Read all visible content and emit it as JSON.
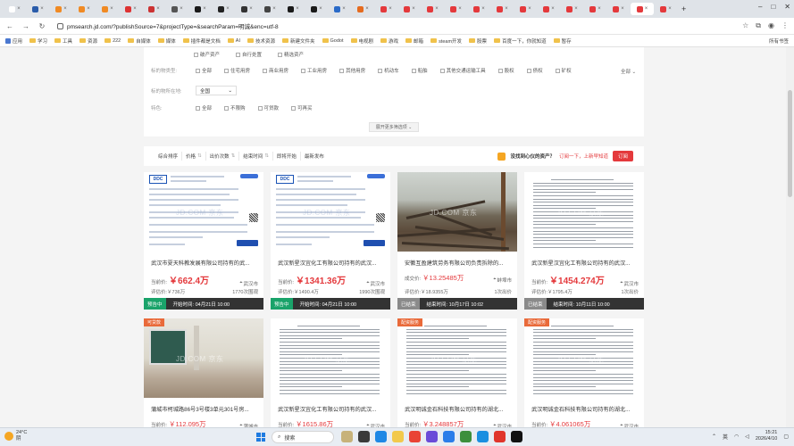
{
  "browser": {
    "tab_glyphs": [
      "",
      "",
      "",
      "",
      "",
      "",
      "",
      "",
      "",
      "",
      "",
      "",
      "",
      "",
      "",
      "",
      "",
      "",
      "",
      "",
      "",
      "",
      "",
      "",
      "",
      "",
      "",
      "",
      ""
    ],
    "tab_colors": [
      "#ffffff",
      "#2a5caa",
      "#f08a24",
      "#f08a24",
      "#f08a24",
      "#d33",
      "#c33",
      "#555",
      "#1a1a1a",
      "#222",
      "#333",
      "#444",
      "#1a1a1a",
      "#1a1a1a",
      "#2a6ac8",
      "#e56b1f",
      "#e4393c",
      "#e4393c",
      "#e4393c",
      "#e4393c",
      "#e4393c",
      "#e4393c",
      "#e4393c",
      "#e4393c",
      "#e4393c",
      "#e4393c",
      "#e4393c",
      "#e4393c",
      "#e4393c"
    ],
    "new_tab": "+",
    "url": "pmsearch.jd.com/?publishSource=7&projectType=&searchParam=明诚&enc=utf-8",
    "bookmarks": [
      "应用",
      "学习",
      "工具",
      "资源",
      "222",
      "自媒体",
      "媒体",
      "插件都是文档",
      "AI",
      "技术资源",
      "新建文件夹",
      "Godot",
      "电视剧",
      "游戏",
      "邮箱",
      "steam开发",
      "股票",
      "百度一下，你就知道",
      "暂存"
    ],
    "bookmarks_right": "所有书签"
  },
  "filters": {
    "row1_options": [
      "破产资产",
      "自行处置",
      "精选资产"
    ],
    "row2_label": "标的物类型:",
    "row2_options": [
      "全部",
      "住宅用房",
      "商业用房",
      "工业用房",
      "其他用房",
      "机动车",
      "船舶",
      "其他交通运输工具",
      "股权",
      "债权",
      "矿权"
    ],
    "row2_more": "全部",
    "row3_label": "标的物所在地:",
    "row3_select": "全国",
    "row4_label": "特色:",
    "row4_options": [
      "全部",
      "不限购",
      "可贷款",
      "可再买"
    ],
    "expand_label": "展开更多筛选项"
  },
  "sort": {
    "items": [
      "综合排序",
      "价格",
      "出价次数",
      "结束时间",
      "即将开始",
      "最新发布"
    ],
    "promo_text": "没找到心仪的资产？",
    "promo_link": "订阅一下，上新早知道",
    "subscribe_button": "订阅"
  },
  "watermark": "JD.COM 京东",
  "cards": [
    {
      "tag": "",
      "cert_logo": "DDC",
      "title": "武汉市夏天科教发展有限公司持有的武...",
      "price_label": "当前价:",
      "price": "￥662.4万",
      "location": "武汉市",
      "eval": "评估价:￥736万",
      "count": "1770次围观",
      "status": "预告中",
      "time": "开始时间: 04月21日 10:00"
    },
    {
      "tag": "",
      "cert_logo": "DDC",
      "title": "武汉新星汉宜化工有限公司持有的武汉...",
      "price_label": "当前价:",
      "price": "￥1341.36万",
      "location": "武汉市",
      "eval": "评估价:￥1490.4万",
      "count": "1990次围观",
      "status": "预告中",
      "time": "开始时间: 04月21日 10:00"
    },
    {
      "tag": "",
      "cert_logo": "",
      "title": "安徽互盈建筑劳务有限公司负责拆除的...",
      "price_label": "成交价:",
      "price": "￥13.25485万",
      "location": "蚌埠市",
      "eval": "评估价:￥18.9355万",
      "count": "1次出价",
      "status": "已结束",
      "time": "结束时间: 10月17日 10:02"
    },
    {
      "tag": "",
      "cert_logo": "",
      "title": "武汉新星汉宜化工有限公司持有的武汉...",
      "price_label": "当前价:",
      "price": "￥1454.274万",
      "location": "武汉市",
      "eval": "评估价:￥1795.4万",
      "count": "1次出价",
      "status": "已结束",
      "time": "结束时间: 10月11日 10:00"
    },
    {
      "tag": "可贷款",
      "cert_logo": "",
      "title": "蒲城市柯城路86号3号楼3单元301号房...",
      "price_label": "当前价:",
      "price": "￥112.095万",
      "location": "蒲城市",
      "eval": "",
      "count": "",
      "status": "",
      "time": ""
    },
    {
      "tag": "",
      "cert_logo": "",
      "title": "武汉新星汉宜化工有限公司持有的武汉...",
      "price_label": "当前价:",
      "price": "￥1615.86万",
      "location": "武汉市",
      "eval": "",
      "count": "",
      "status": "",
      "time": ""
    },
    {
      "tag": "配资服务",
      "cert_logo": "",
      "title": "武汉明诚金石科技有限公司持有的湖北...",
      "price_label": "当前价:",
      "price": "￥3.248857万",
      "location": "武汉市",
      "eval": "",
      "count": "",
      "status": "",
      "time": ""
    },
    {
      "tag": "配资服务",
      "cert_logo": "",
      "title": "武汉明诚金石科技有限公司持有的湖北...",
      "price_label": "当前价:",
      "price": "￥4.061065万",
      "location": "武汉市",
      "eval": "",
      "count": "",
      "status": "",
      "time": ""
    }
  ],
  "taskbar": {
    "temp": "24°C",
    "weather": "阴",
    "search": "搜索",
    "lang": "英",
    "time": "15:21",
    "date": "2026/4/10"
  },
  "colors": {
    "jd_red": "#e4393c",
    "status_green": "#1aa36a",
    "status_grey": "#8a8a8a",
    "tag_orange": "#e96a3a"
  }
}
